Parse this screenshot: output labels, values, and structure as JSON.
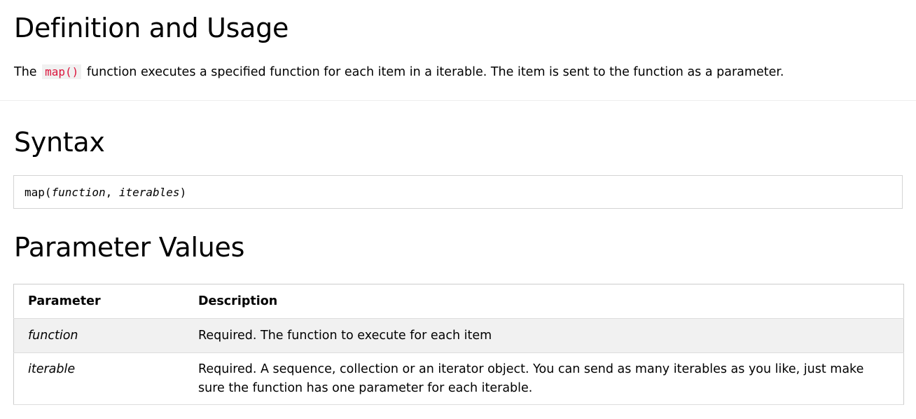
{
  "definition": {
    "heading": "Definition and Usage",
    "intro_before": "The",
    "intro_code": "map()",
    "intro_after": "function executes a specified function for each item in a iterable. The item is sent to the function as a parameter."
  },
  "syntax": {
    "heading": "Syntax",
    "code_prefix": "map(",
    "code_arg1": "function",
    "code_sep": ", ",
    "code_arg2": "iterables",
    "code_suffix": ")"
  },
  "parameters": {
    "heading": "Parameter Values",
    "headers": [
      "Parameter",
      "Description"
    ],
    "rows": [
      {
        "name": "function",
        "description": "Required. The function to execute for each item"
      },
      {
        "name": "iterable",
        "description": "Required. A sequence, collection or an iterator object. You can send as many iterables as you like, just make sure the function has one parameter for each iterable."
      }
    ]
  },
  "colors": {
    "inline_code_text": "#dc143c",
    "inline_code_bg": "#f1f1f1",
    "shaded_row_bg": "#f1f1f1"
  }
}
